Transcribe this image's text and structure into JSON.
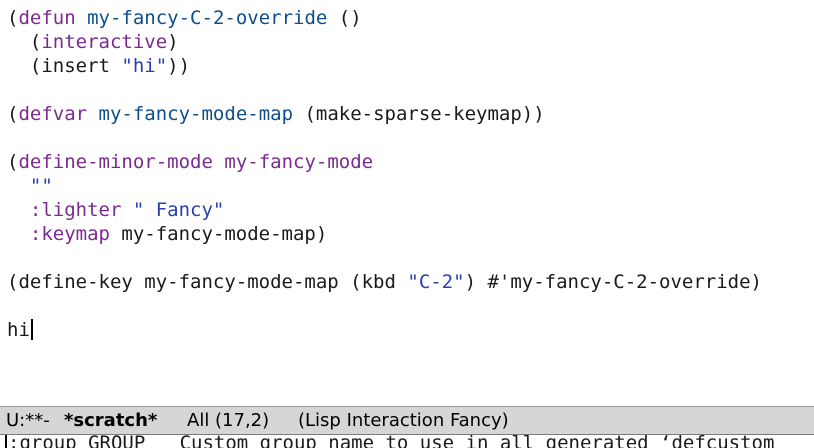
{
  "buffer": {
    "l1": {
      "p1": "(",
      "kw": "defun",
      "sp": " ",
      "fn": "my-fancy-C-2-override",
      "rest": " ()"
    },
    "l2": {
      "indent": "  (",
      "kw": "interactive",
      "rest": ")"
    },
    "l3": {
      "indent": "  (insert ",
      "str": "\"hi\"",
      "rest": "))"
    },
    "l5": {
      "p1": "(",
      "kw": "defvar",
      "sp": " ",
      "fn": "my-fancy-mode-map",
      "rest": " (make-sparse-keymap))"
    },
    "l7": {
      "p1": "(",
      "kw": "define-minor-mode",
      "sp": " ",
      "fn": "my-fancy-mode",
      "rest": ""
    },
    "l8": {
      "indent": "  ",
      "str": "\"\""
    },
    "l9": {
      "indent": "  ",
      "kw": ":lighter",
      "sp": " ",
      "str": "\" Fancy\""
    },
    "l10": {
      "indent": "  ",
      "kw": ":keymap",
      "rest": " my-fancy-mode-map)"
    },
    "l12": {
      "p1": "(define-key my-fancy-mode-map (kbd ",
      "str": "\"C-2\"",
      "rest": ") #'my-fancy-C-2-override)"
    },
    "l14": {
      "text": "hi"
    }
  },
  "modeline": {
    "status": "U:**-",
    "buffer_name": "*scratch*",
    "position": "All (17,2)",
    "modes": "(Lisp Interaction Fancy)"
  },
  "echo": {
    "text": ":group GROUP   Custom group name to use in all generated ‘defcustom"
  }
}
